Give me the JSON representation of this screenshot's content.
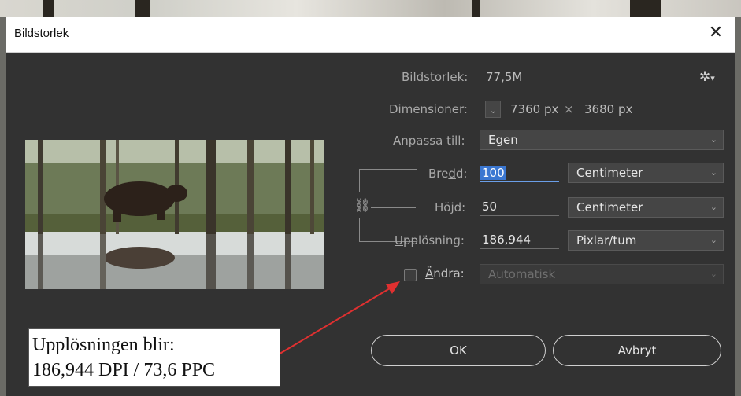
{
  "dialog": {
    "title": "Bildstorlek",
    "close_glyph": "✕"
  },
  "info": {
    "size_label": "Bildstorlek:",
    "size_value": "77,5M",
    "dims_label": "Dimensioner:",
    "dims_width": "7360 px",
    "dims_times": "×",
    "dims_height": "3680 px",
    "gear_icon": "gear-icon"
  },
  "fit": {
    "label": "Anpassa till:",
    "value": "Egen"
  },
  "width": {
    "label_a": "Bre",
    "label_u": "d",
    "label_b": "d:",
    "value": "100",
    "unit": "Centimeter"
  },
  "height": {
    "label_a": "Hö",
    "label_u": "j",
    "label_b": "d:",
    "value": "50",
    "unit": "Centimeter"
  },
  "resolution": {
    "label_u": "U",
    "label_rest": "pplösning:",
    "value": "186,944",
    "unit": "Pixlar/tum"
  },
  "resample": {
    "label_u": "Ä",
    "label_rest": "ndra:",
    "checked": false,
    "value": "Automatisk"
  },
  "buttons": {
    "ok": "OK",
    "cancel": "Avbryt"
  },
  "note": {
    "line1": "Upplösningen blir:",
    "line2": "186,944 DPI / 73,6 PPC"
  },
  "colors": {
    "dialog_bg": "#323232",
    "arrow": "#e03030",
    "selection": "#3b77d1"
  }
}
